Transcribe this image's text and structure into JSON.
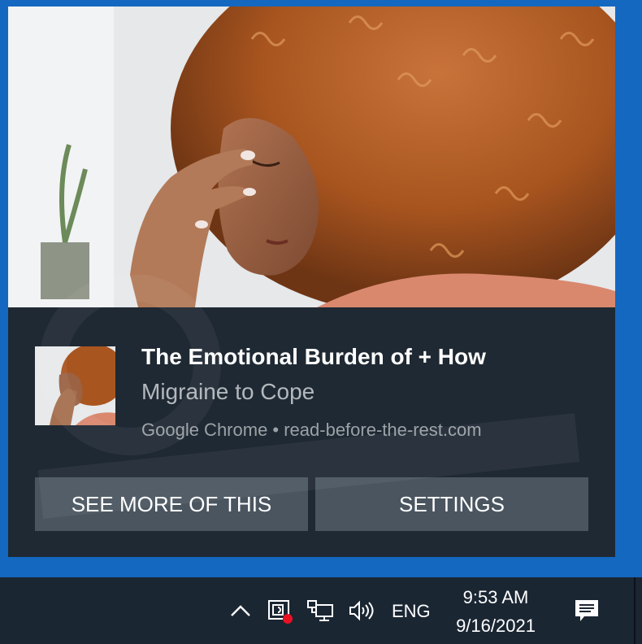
{
  "notification": {
    "title": "The Emotional Burden of + How",
    "subtitle": "Migraine to Cope",
    "source": "Google Chrome • read-before-the-rest.com",
    "buttons": {
      "see_more": "SEE MORE OF THIS",
      "settings": "SETTINGS"
    }
  },
  "taskbar": {
    "language": "ENG",
    "time": "9:53 AM",
    "date": "9/16/2021",
    "icons": [
      "chevron-up-icon",
      "meet-now-icon",
      "network-icon",
      "volume-icon",
      "action-center-icon"
    ]
  },
  "colors": {
    "desktop": "#1468c0",
    "toast_bg": "#1f2933",
    "button_bg": "#4a5560",
    "taskbar_bg": "#1b2633",
    "badge_red": "#e81123"
  }
}
